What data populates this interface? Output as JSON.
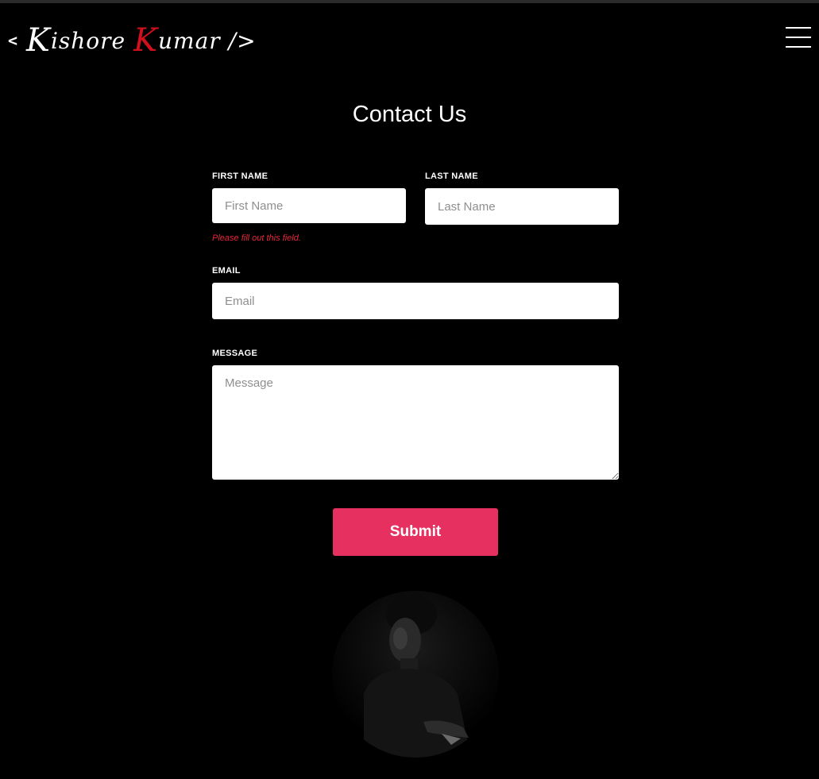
{
  "header": {
    "logo": {
      "open_bracket": "<",
      "first_initial": "K",
      "first_rest": "ishore",
      "last_initial": "K",
      "last_rest": "umar",
      "close_bracket": "/>"
    },
    "menu_icon": "hamburger-icon"
  },
  "page": {
    "title": "Contact Us"
  },
  "form": {
    "first_name": {
      "label": "FIRST NAME",
      "placeholder": "First Name",
      "value": "",
      "error": "Please fill out this field."
    },
    "last_name": {
      "label": "LAST NAME",
      "placeholder": "Last Name",
      "value": ""
    },
    "email": {
      "label": "EMAIL",
      "placeholder": "Email",
      "value": ""
    },
    "message": {
      "label": "MESSAGE",
      "placeholder": "Message",
      "value": ""
    },
    "submit_label": "Submit"
  },
  "colors": {
    "background": "#000000",
    "accent": "#d0101c",
    "button": "#e6305f",
    "error": "#e8263b"
  }
}
